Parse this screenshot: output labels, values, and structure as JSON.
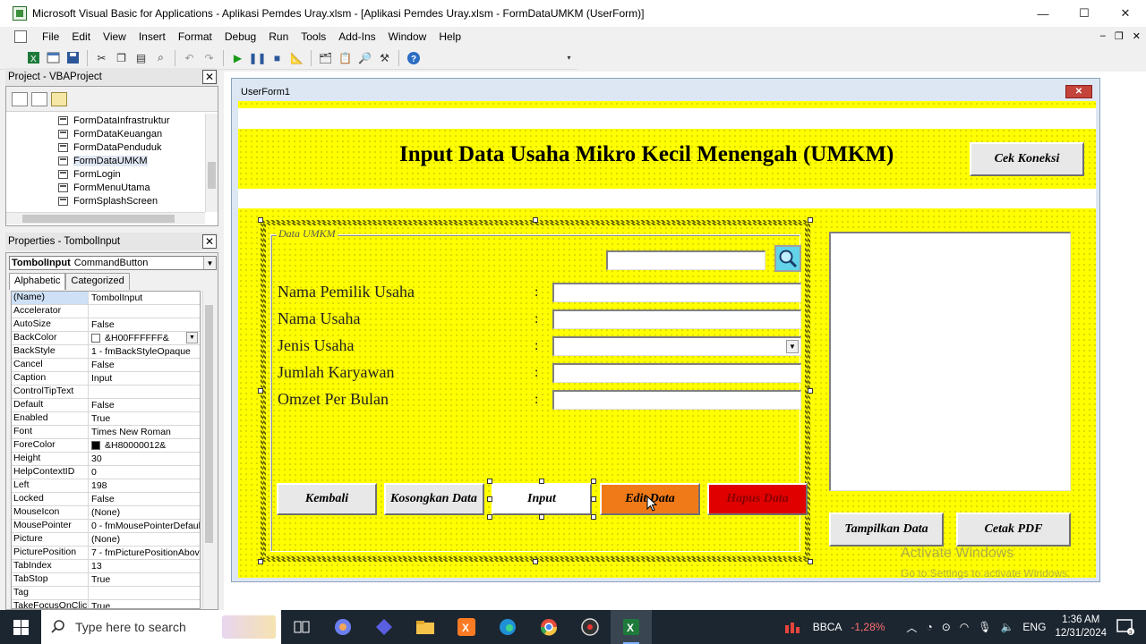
{
  "window": {
    "title": "Microsoft Visual Basic for Applications - Aplikasi Pemdes Uray.xlsm - [Aplikasi Pemdes Uray.xlsm - FormDataUMKM (UserForm)]",
    "minimize": "—",
    "maximize": "☐",
    "close": "✕"
  },
  "menu": [
    "File",
    "Edit",
    "View",
    "Insert",
    "Format",
    "Debug",
    "Run",
    "Tools",
    "Add-Ins",
    "Window",
    "Help"
  ],
  "project_panel": {
    "title": "Project - VBAProject",
    "items": [
      {
        "label": "FormDataInfrastruktur",
        "selected": false
      },
      {
        "label": "FormDataKeuangan",
        "selected": false
      },
      {
        "label": "FormDataPenduduk",
        "selected": false
      },
      {
        "label": "FormDataUMKM",
        "selected": true
      },
      {
        "label": "FormLogin",
        "selected": false
      },
      {
        "label": "FormMenuUtama",
        "selected": false
      },
      {
        "label": "FormSplashScreen",
        "selected": false
      }
    ]
  },
  "properties_panel": {
    "title": "Properties - TombolInput",
    "object_name": "TombolInput",
    "object_type": "CommandButton",
    "tabs": [
      "Alphabetic",
      "Categorized"
    ],
    "rows": [
      {
        "name": "(Name)",
        "value": "TombolInput"
      },
      {
        "name": "Accelerator",
        "value": ""
      },
      {
        "name": "AutoSize",
        "value": "False"
      },
      {
        "name": "BackColor",
        "value": "&H00FFFFFF&",
        "swatch": "#ffffff",
        "dropdown": true
      },
      {
        "name": "BackStyle",
        "value": "1 - fmBackStyleOpaque"
      },
      {
        "name": "Cancel",
        "value": "False"
      },
      {
        "name": "Caption",
        "value": "Input"
      },
      {
        "name": "ControlTipText",
        "value": ""
      },
      {
        "name": "Default",
        "value": "False"
      },
      {
        "name": "Enabled",
        "value": "True"
      },
      {
        "name": "Font",
        "value": "Times New Roman"
      },
      {
        "name": "ForeColor",
        "value": "&H80000012&",
        "swatch": "#000000"
      },
      {
        "name": "Height",
        "value": "30"
      },
      {
        "name": "HelpContextID",
        "value": "0"
      },
      {
        "name": "Left",
        "value": "198"
      },
      {
        "name": "Locked",
        "value": "False"
      },
      {
        "name": "MouseIcon",
        "value": "(None)"
      },
      {
        "name": "MousePointer",
        "value": "0 - fmMousePointerDefault"
      },
      {
        "name": "Picture",
        "value": "(None)"
      },
      {
        "name": "PicturePosition",
        "value": "7 - fmPicturePositionAbove"
      },
      {
        "name": "TabIndex",
        "value": "13"
      },
      {
        "name": "TabStop",
        "value": "True"
      },
      {
        "name": "Tag",
        "value": ""
      },
      {
        "name": "TakeFocusOnClick",
        "value": "True"
      }
    ]
  },
  "userform": {
    "title": "UserForm1",
    "close": "✕",
    "header_title": "Input Data Usaha Mikro Kecil Menengah (UMKM)",
    "cek_koneksi": "Cek Koneksi",
    "frame_caption": "Data UMKM",
    "colon": ":",
    "fields": [
      {
        "label": "Nama Pemilik Usaha",
        "type": "text",
        "value": ""
      },
      {
        "label": "Nama Usaha",
        "type": "text",
        "value": ""
      },
      {
        "label": "Jenis Usaha",
        "type": "combo",
        "value": ""
      },
      {
        "label": "Jumlah Karyawan",
        "type": "text",
        "value": ""
      },
      {
        "label": "Omzet Per Bulan",
        "type": "text",
        "value": ""
      }
    ],
    "search_value": "",
    "buttons": {
      "kembali": "Kembali",
      "kosongkan": "Kosongkan Data",
      "input": "Input",
      "edit": "Edit Data",
      "hapus": "Hapus Data",
      "tampilkan": "Tampilkan Data",
      "cetak": "Cetak PDF"
    },
    "colors": {
      "canvas": "#ffff00",
      "edit_button": "#f07a18",
      "hapus_button": "#e00000",
      "search_button": "#62d3e8"
    }
  },
  "watermark": {
    "line1": "Activate Windows",
    "line2": "Go to Settings to activate Windows."
  },
  "taskbar": {
    "search_placeholder": "Type here to search",
    "stock_name": "BBCA",
    "stock_change": "-1,28%",
    "language": "ENG",
    "time": "1:36 AM",
    "date": "12/31/2024"
  }
}
